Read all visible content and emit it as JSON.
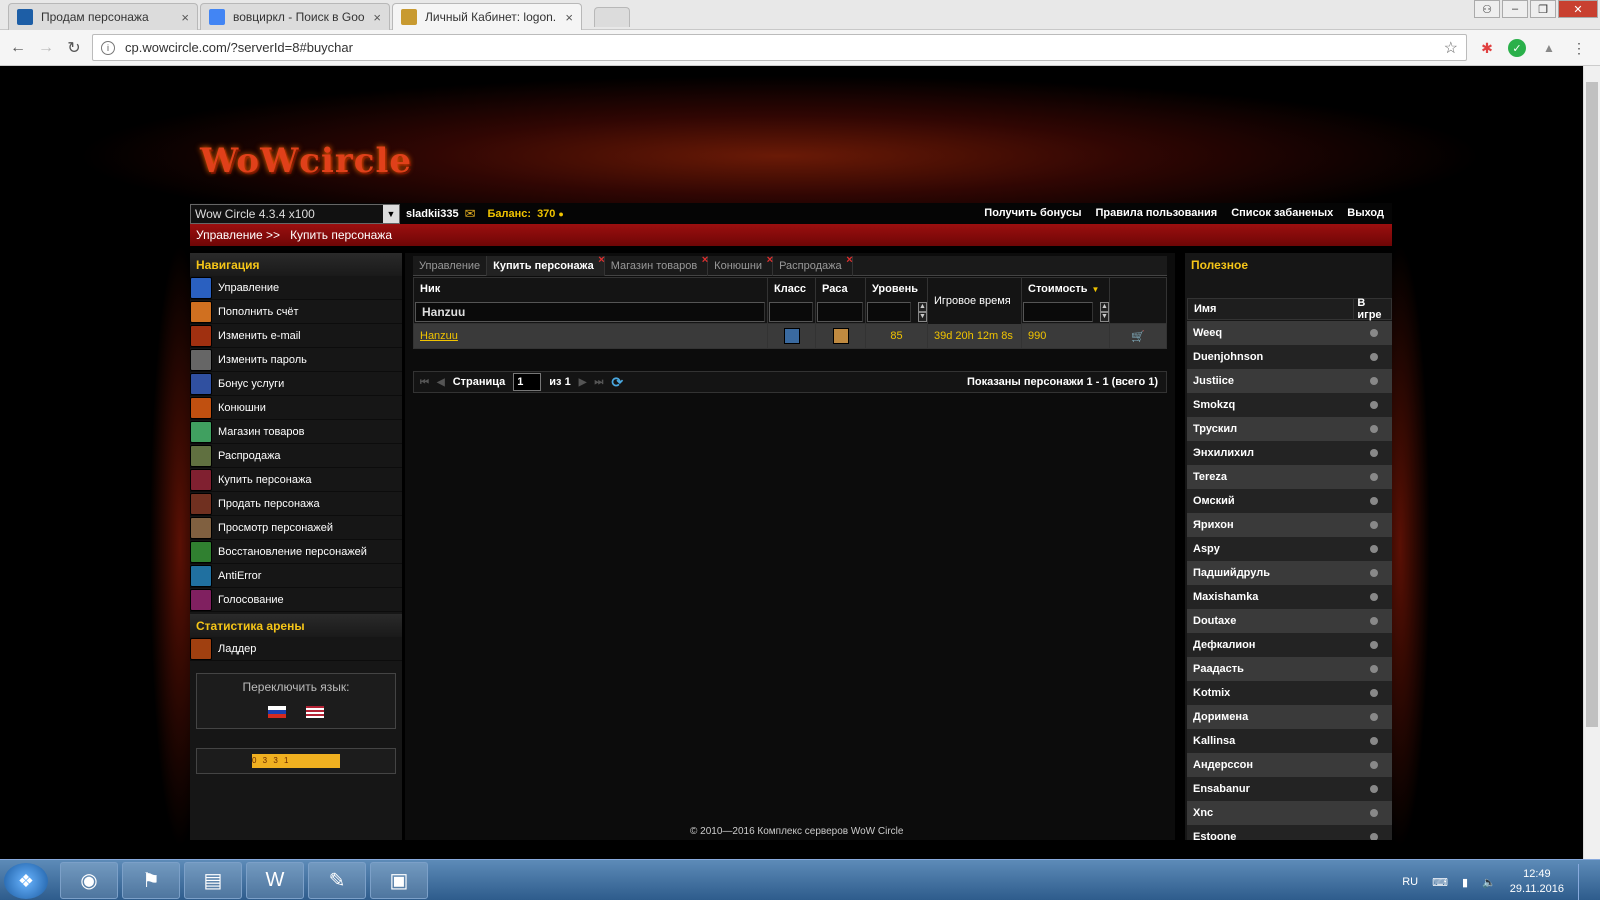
{
  "browser": {
    "tabs": [
      {
        "title": "Продам персонажа",
        "favicon_color": "#1d5ea6"
      },
      {
        "title": "вовциркл - Поиск в Goo",
        "favicon_color": "#4285f4"
      },
      {
        "title": "Личный Кабинет: logon.",
        "favicon_color": "#c89a30",
        "active": true
      }
    ],
    "close_glyph": "×",
    "address": "cp.wowcircle.com/?serverId=8#buychar"
  },
  "site": {
    "logo_text": "WoWcircle",
    "realm_select": "Wow Circle 4.3.4 x100",
    "username": "sladkii335",
    "balance_label": "Баланс:",
    "balance_value": "370",
    "top_links": [
      "Получить бонусы",
      "Правила пользования",
      "Список забаненых",
      "Выход"
    ],
    "breadcrumb": [
      "Управление >>",
      "Купить персонажа"
    ]
  },
  "nav": {
    "heading": "Навигация",
    "items": [
      {
        "label": "Управление",
        "icon_color": "#2a60c0"
      },
      {
        "label": "Пополнить счёт",
        "icon_color": "#d07020"
      },
      {
        "label": "Изменить e-mail",
        "icon_color": "#a03010"
      },
      {
        "label": "Изменить пароль",
        "icon_color": "#666666"
      },
      {
        "label": "Бонус услуги",
        "icon_color": "#3050a0"
      },
      {
        "label": "Конюшни",
        "icon_color": "#c05010"
      },
      {
        "label": "Магазин товаров",
        "icon_color": "#40a060"
      },
      {
        "label": "Распродажа",
        "icon_color": "#607040"
      },
      {
        "label": "Купить персонажа",
        "icon_color": "#802030"
      },
      {
        "label": "Продать персонажа",
        "icon_color": "#703020"
      },
      {
        "label": "Просмотр персонажей",
        "icon_color": "#806040"
      },
      {
        "label": "Восстановление персонажей",
        "icon_color": "#308030"
      },
      {
        "label": "AntiError",
        "icon_color": "#2070a0"
      },
      {
        "label": "Голосование",
        "icon_color": "#802060"
      }
    ],
    "arena_heading": "Статистика арены",
    "arena_items": [
      {
        "label": "Ладдер",
        "icon_color": "#a04010"
      }
    ],
    "lang_label": "Переключить язык:",
    "counter_text": "0 3 3 1"
  },
  "content": {
    "tabs": [
      {
        "label": "Управление",
        "active": false,
        "closable": false
      },
      {
        "label": "Купить персонажа",
        "active": true,
        "closable": true
      },
      {
        "label": "Магазин товаров",
        "active": false,
        "closable": true
      },
      {
        "label": "Конюшни",
        "active": false,
        "closable": true
      },
      {
        "label": "Распродажа",
        "active": false,
        "closable": true
      }
    ],
    "columns": [
      "Ник",
      "Класс",
      "Раса",
      "Уровень",
      "Игровое время",
      "Стоимость"
    ],
    "filter_nick": "Hanzuu",
    "rows": [
      {
        "nick": "Hanzuu",
        "level": "85",
        "playtime": "39d 20h 12m 8s",
        "cost": "990"
      }
    ],
    "pager": {
      "page_label": "Страница",
      "page_value": "1",
      "of_label": "из 1",
      "info": "Показаны персонажи 1 - 1 (всего 1)"
    }
  },
  "right": {
    "heading": "Полезное",
    "columns": [
      "Имя",
      "В игре"
    ],
    "players": [
      "Weeq",
      "Duenjohnson",
      "Justiice",
      "Smokzq",
      "Трускил",
      "Энхилихил",
      "Tereza",
      "Омский",
      "Ярихон",
      "Aspy",
      "Падшийдруль",
      "Maxishamka",
      "Doutaxe",
      "Дефкалион",
      "Paадасть",
      "Kotmix",
      "Доримена",
      "Kallinsa",
      "Андерссон",
      "Ensabanur",
      "Xnc",
      "Estoone"
    ]
  },
  "footer": "© 2010—2016 Комплекс серверов WoW Circle",
  "taskbar": {
    "lang": "RU",
    "time": "12:49",
    "date": "29.11.2016"
  }
}
